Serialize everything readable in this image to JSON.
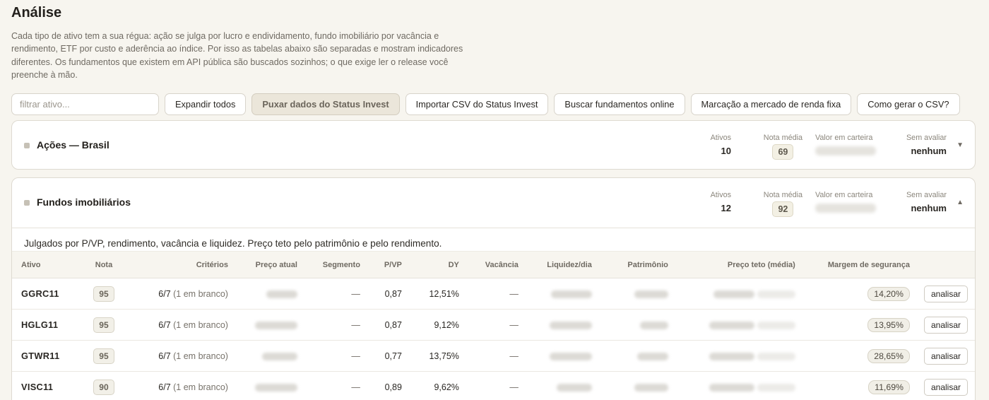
{
  "header": {
    "title": "Análise",
    "intro": "Cada tipo de ativo tem a sua régua: ação se julga por lucro e endividamento, fundo imobiliário por vacância e rendimento, ETF por custo e aderência ao índice. Por isso as tabelas abaixo são separadas e mostram indicadores diferentes. Os fundamentos que existem em API pública são buscados sozinhos; o que exige ler o release você preenche à mão."
  },
  "toolbar": {
    "filter_placeholder": "filtrar ativo...",
    "expand_all": "Expandir todos",
    "pull_status_invest": "Puxar dados do Status Invest",
    "import_csv": "Importar CSV do Status Invest",
    "fetch_fundamentals": "Buscar fundamentos online",
    "fixed_income_mtm": "Marcação a mercado de renda fixa",
    "how_csv": "Como gerar o CSV?"
  },
  "stat_labels": {
    "ativos": "Ativos",
    "nota_media": "Nota média",
    "valor_carteira": "Valor em carteira",
    "sem_avaliar": "Sem avaliar"
  },
  "sections": [
    {
      "title": "Ações — Brasil",
      "ativos": "10",
      "nota_media": "69",
      "sem_avaliar": "nenhum",
      "expanded": false
    },
    {
      "title": "Fundos imobiliários",
      "ativos": "12",
      "nota_media": "92",
      "sem_avaliar": "nenhum",
      "expanded": true,
      "description": "Julgados por P/VP, rendimento, vacância e liquidez. Preço teto pelo patrimônio e pelo rendimento."
    }
  ],
  "table": {
    "columns": [
      "Ativo",
      "Nota",
      "Critérios",
      "Preço atual",
      "Segmento",
      "P/VP",
      "DY",
      "Vacância",
      "Liquidez/dia",
      "Patrimônio",
      "Preço teto (média)",
      "Margem de segurança"
    ],
    "action_label": "analisar",
    "rows": [
      {
        "ativo": "GGRC11",
        "nota": "95",
        "criterios": "6/7",
        "criterios_sub": "(1 em branco)",
        "segmento": "—",
        "pvp": "0,87",
        "dy": "12,51%",
        "vacancia": "—",
        "margem": "14,20%"
      },
      {
        "ativo": "HGLG11",
        "nota": "95",
        "criterios": "6/7",
        "criterios_sub": "(1 em branco)",
        "segmento": "—",
        "pvp": "0,87",
        "dy": "9,12%",
        "vacancia": "—",
        "margem": "13,95%"
      },
      {
        "ativo": "GTWR11",
        "nota": "95",
        "criterios": "6/7",
        "criterios_sub": "(1 em branco)",
        "segmento": "—",
        "pvp": "0,77",
        "dy": "13,75%",
        "vacancia": "—",
        "margem": "28,65%"
      },
      {
        "ativo": "VISC11",
        "nota": "90",
        "criterios": "6/7",
        "criterios_sub": "(1 em branco)",
        "segmento": "—",
        "pvp": "0,89",
        "dy": "9,62%",
        "vacancia": "—",
        "margem": "11,69%"
      }
    ]
  },
  "icons": {
    "collapsed": "chevron-down-icon",
    "expanded": "chevron-up-icon"
  }
}
